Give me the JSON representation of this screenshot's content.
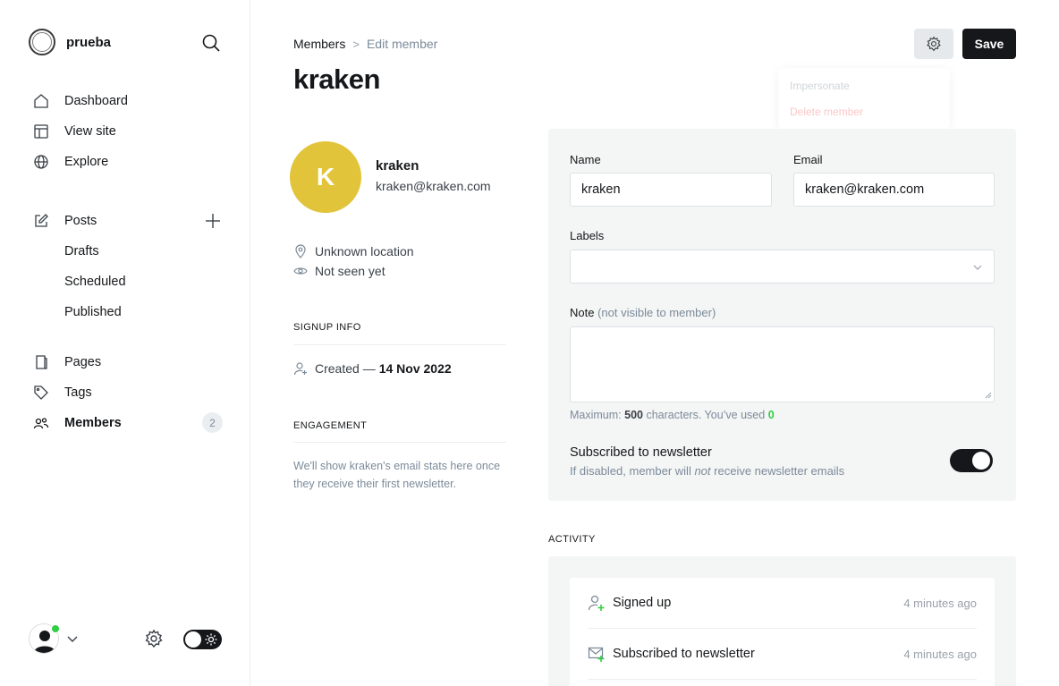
{
  "brand": {
    "name": "prueba"
  },
  "nav": {
    "dashboard": "Dashboard",
    "view_site": "View site",
    "explore": "Explore",
    "posts": "Posts",
    "drafts": "Drafts",
    "scheduled": "Scheduled",
    "published": "Published",
    "pages": "Pages",
    "tags": "Tags",
    "members": "Members",
    "members_count": "2"
  },
  "breadcrumb": {
    "parent": "Members",
    "separator": ">",
    "current": "Edit member"
  },
  "page": {
    "title": "kraken"
  },
  "toolbar": {
    "save_label": "Save"
  },
  "dropdown": {
    "impersonate": "Impersonate",
    "delete": "Delete member"
  },
  "member": {
    "initial": "K",
    "name": "kraken",
    "email": "kraken@kraken.com",
    "location": "Unknown location",
    "seen": "Not seen yet"
  },
  "signup": {
    "section_title": "SIGNUP INFO",
    "created_label": "Created —",
    "created_date": "14 Nov 2022"
  },
  "engagement": {
    "section_title": "ENGAGEMENT",
    "text": "We'll show kraken's email stats here once they receive their first newsletter."
  },
  "form": {
    "name_label": "Name",
    "name_value": "kraken",
    "email_label": "Email",
    "email_value": "kraken@kraken.com",
    "labels_label": "Labels",
    "note_label": "Note",
    "note_hint": "(not visible to member)",
    "char_prefix": "Maximum:",
    "char_max": "500",
    "char_mid": "characters. You’ve used",
    "char_used": "0",
    "newsletter_title": "Subscribed to newsletter",
    "newsletter_desc_1": "If disabled, member will",
    "newsletter_desc_em": "not",
    "newsletter_desc_2": "receive newsletter emails",
    "newsletter_enabled": true
  },
  "activity": {
    "section_title": "ACTIVITY",
    "items": [
      {
        "label": "Signed up",
        "time": "4 minutes ago",
        "icon": "user-add-icon"
      },
      {
        "label": "Subscribed to newsletter",
        "time": "4 minutes ago",
        "icon": "mail-add-icon"
      }
    ]
  },
  "colors": {
    "accent_green": "#30cf43",
    "avatar_yellow": "#e2c43a",
    "dark": "#15171a"
  }
}
